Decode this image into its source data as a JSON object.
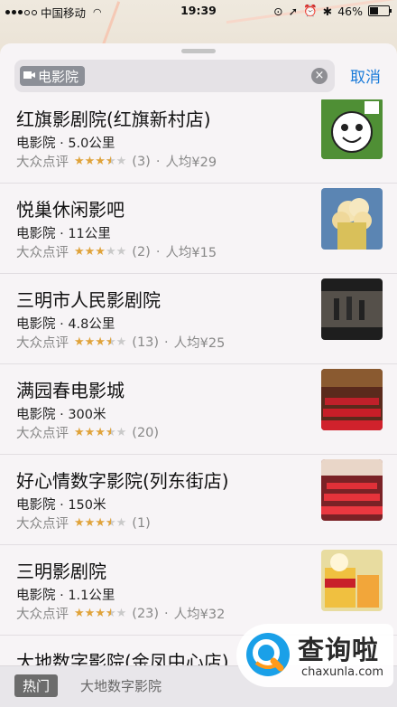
{
  "status_bar": {
    "carrier": "中国移动",
    "time": "19:39",
    "battery": "46%"
  },
  "search": {
    "chip_label": "电影院",
    "cancel_label": "取消"
  },
  "results": [
    {
      "name": "红旗影剧院(红旗新村店)",
      "category": "电影院",
      "distance": "5.0公里",
      "source": "大众点评",
      "stars": 3.5,
      "reviews": "(3)",
      "price": "人均¥29"
    },
    {
      "name": "悦巢休闲影吧",
      "category": "电影院",
      "distance": "11公里",
      "source": "大众点评",
      "stars": 3,
      "reviews": "(2)",
      "price": "人均¥15"
    },
    {
      "name": "三明市人民影剧院",
      "category": "电影院",
      "distance": "4.8公里",
      "source": "大众点评",
      "stars": 3.5,
      "reviews": "(13)",
      "price": "人均¥25"
    },
    {
      "name": "满园春电影城",
      "category": "电影院",
      "distance": "300米",
      "source": "大众点评",
      "stars": 3.5,
      "reviews": "(20)",
      "price": ""
    },
    {
      "name": "好心情数字影院(列东街店)",
      "category": "电影院",
      "distance": "150米",
      "source": "大众点评",
      "stars": 3.5,
      "reviews": "(1)",
      "price": ""
    },
    {
      "name": "三明影剧院",
      "category": "电影院",
      "distance": "1.1公里",
      "source": "大众点评",
      "stars": 3.5,
      "reviews": "(23)",
      "price": "人均¥32"
    },
    {
      "name": "大地数字影院(金凤中心店)",
      "category": "",
      "distance": "",
      "source": "",
      "stars": 0,
      "reviews": "",
      "price": ""
    }
  ],
  "bottom_bar": {
    "hot_label": "热门",
    "suggestion": "大地数字影院"
  },
  "watermark": {
    "title": "查询啦",
    "domain": "chaxunla.com"
  },
  "colors": {
    "accent": "#1a7bd9",
    "star": "#e0a33a"
  }
}
